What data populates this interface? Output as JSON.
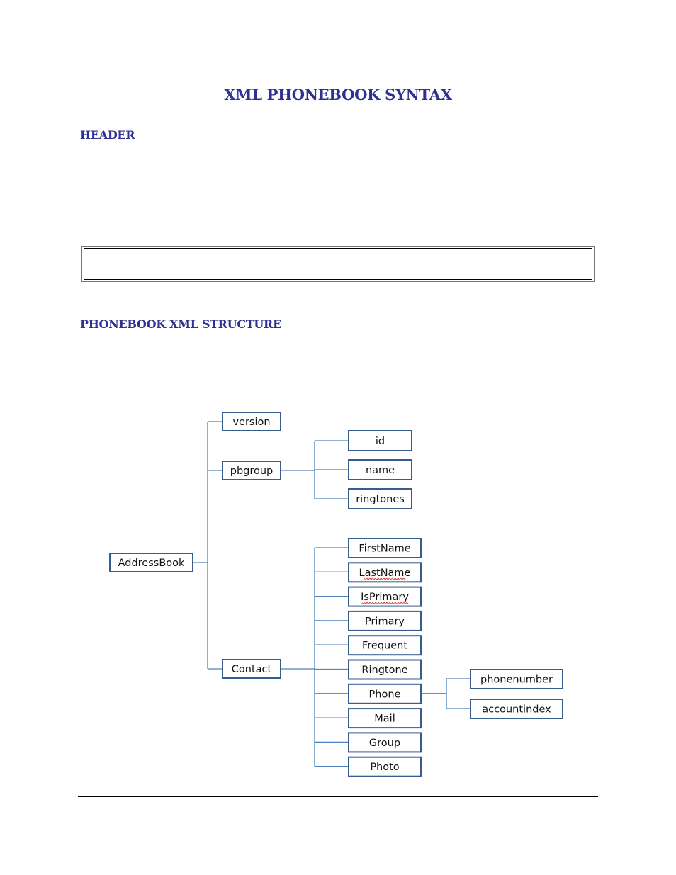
{
  "document": {
    "title": "XML PHONEBOOK SYNTAX",
    "sections": [
      {
        "heading": "HEADER"
      },
      {
        "heading": "PHONEBOOK XML STRUCTURE"
      }
    ],
    "code_box": {
      "content": ""
    }
  },
  "colors": {
    "heading": "#2e3192",
    "node_border": "#385d8a",
    "connector": "#4f81bd",
    "spellcheck": "#d0342c"
  },
  "tree": {
    "root": "AddressBook",
    "children": [
      {
        "label": "version",
        "children": []
      },
      {
        "label": "pbgroup",
        "children": [
          {
            "label": "id"
          },
          {
            "label": "name"
          },
          {
            "label": "ringtones"
          }
        ]
      },
      {
        "label": "Contact",
        "children": [
          {
            "label": "FirstName"
          },
          {
            "label": "LastName",
            "spellcheck": true
          },
          {
            "label": "IsPrimary",
            "spellcheck": true
          },
          {
            "label": "Primary"
          },
          {
            "label": "Frequent"
          },
          {
            "label": "Ringtone"
          },
          {
            "label": "Phone",
            "children": [
              {
                "label": "phonenumber"
              },
              {
                "label": "accountindex"
              }
            ]
          },
          {
            "label": "Mail"
          },
          {
            "label": "Group"
          },
          {
            "label": "Photo"
          }
        ]
      }
    ]
  }
}
